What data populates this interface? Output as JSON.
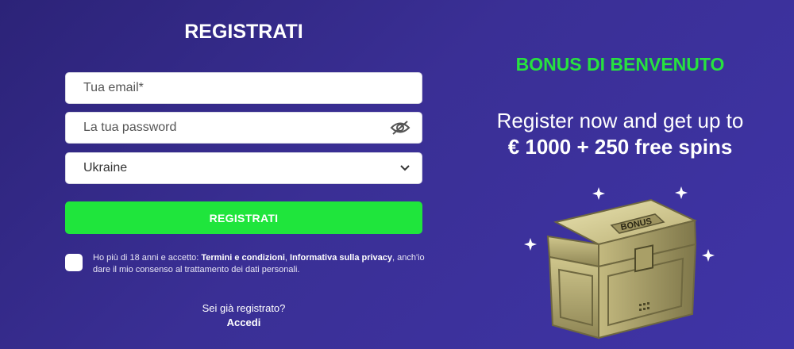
{
  "form": {
    "title": "REGISTRATI",
    "email_placeholder": "Tua email*",
    "password_placeholder": "La tua password",
    "country_value": "Ukraine",
    "submit_label": "REGISTRATI",
    "consent": {
      "part1": "Ho più di 18 anni e accetto: ",
      "terms": "Termini e condizioni",
      "sep": ", ",
      "privacy": "Informativa sulla privacy",
      "part2": ", anch'io dare il mio consenso al trattamento dei dati personali."
    },
    "already_registered": "Sei già registrato?",
    "login_link": "Accedi"
  },
  "bonus": {
    "title": "BONUS DI BENVENUTO",
    "line1": "Register now and get up to",
    "line2": "€ 1000 + 250 free spins",
    "chest_label": "BONUS"
  },
  "colors": {
    "background": "#3a2f95",
    "accent_green": "#1fe53c",
    "bonus_title_green": "#27e23f"
  },
  "icons": {
    "password_toggle": "eye-slash-icon",
    "country_dropdown": "chevron-down-icon"
  }
}
